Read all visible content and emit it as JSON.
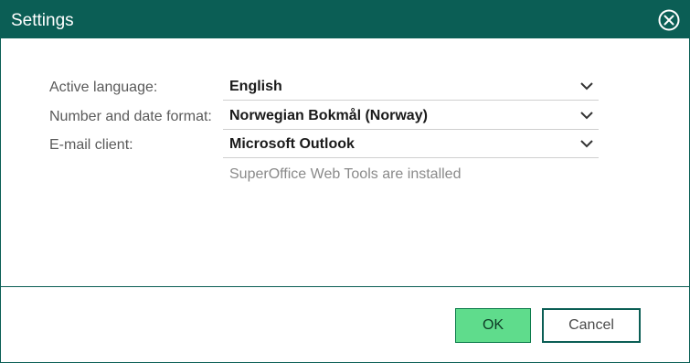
{
  "dialog": {
    "title": "Settings",
    "close_icon": "close-circle-icon"
  },
  "fields": [
    {
      "label": "Active language:",
      "value": "English",
      "icon": "chevron-down-icon"
    },
    {
      "label": "Number and date format:",
      "value": "Norwegian Bokmål (Norway)",
      "icon": "chevron-down-icon"
    },
    {
      "label": "E-mail client:",
      "value": "Microsoft Outlook",
      "icon": "chevron-down-icon"
    }
  ],
  "info": "SuperOffice Web Tools are installed",
  "buttons": {
    "ok": "OK",
    "cancel": "Cancel"
  },
  "colors": {
    "titlebar": "#0b5e55",
    "ok_button": "#5fdc8c",
    "accent_border": "#0b5e55"
  }
}
